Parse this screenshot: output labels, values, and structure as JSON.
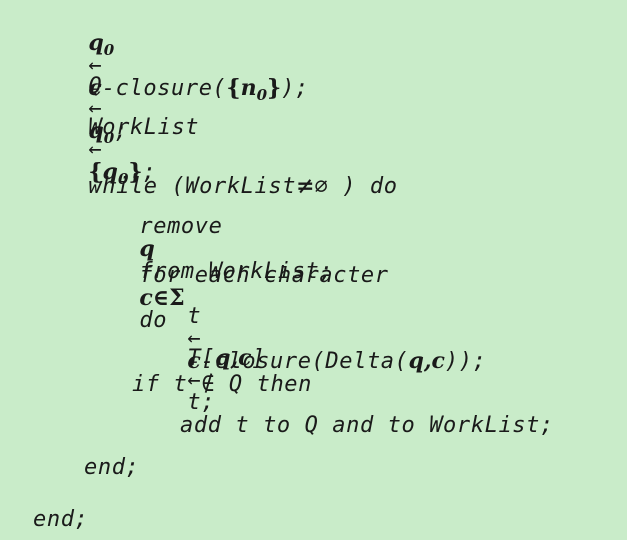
{
  "pseudocode": {
    "l1": {
      "lhs": "q",
      "lhs_sub": "0",
      "arrow": "←",
      "eps": "ϵ",
      "fn": "-closure(",
      "set_open": "{",
      "arg": "n",
      "arg_sub": "0",
      "set_close": "}",
      "tail": ");"
    },
    "l2": {
      "lhs": "Q",
      "arrow": "←",
      "rhs": "q",
      "rhs_sub": "0",
      "tail": ";"
    },
    "l3": {
      "lhs": "WorkList",
      "arrow": "←",
      "set_open": "{",
      "rhs": "q",
      "rhs_sub": "0",
      "set_close": "}",
      "tail": ";"
    },
    "l4": {
      "kw": "while (WorkList",
      "op": "≠",
      "empty": "∅",
      "tail": ") do"
    },
    "l5": {
      "pre": "remove",
      "var": "q",
      "post": "from WorkList;"
    },
    "l6": {
      "pre": "for each character",
      "var": "c",
      "op": "∈",
      "sigma": "Σ",
      "post": "do"
    },
    "l7": {
      "lhs": "t",
      "arrow": "←",
      "eps": "ϵ",
      "fn": "-closure(Delta(",
      "args": "q,c",
      "tail": "));"
    },
    "l8": {
      "pre": "T[",
      "args": "q,c",
      "post": "]",
      "arrow": "←",
      "tail": "t;"
    },
    "l9": {
      "text": "if t ∉ Q then"
    },
    "l10": {
      "text": "add t to Q and to WorkList;"
    },
    "l11": {
      "text": "end;"
    },
    "l12": {
      "text": "end;"
    }
  }
}
